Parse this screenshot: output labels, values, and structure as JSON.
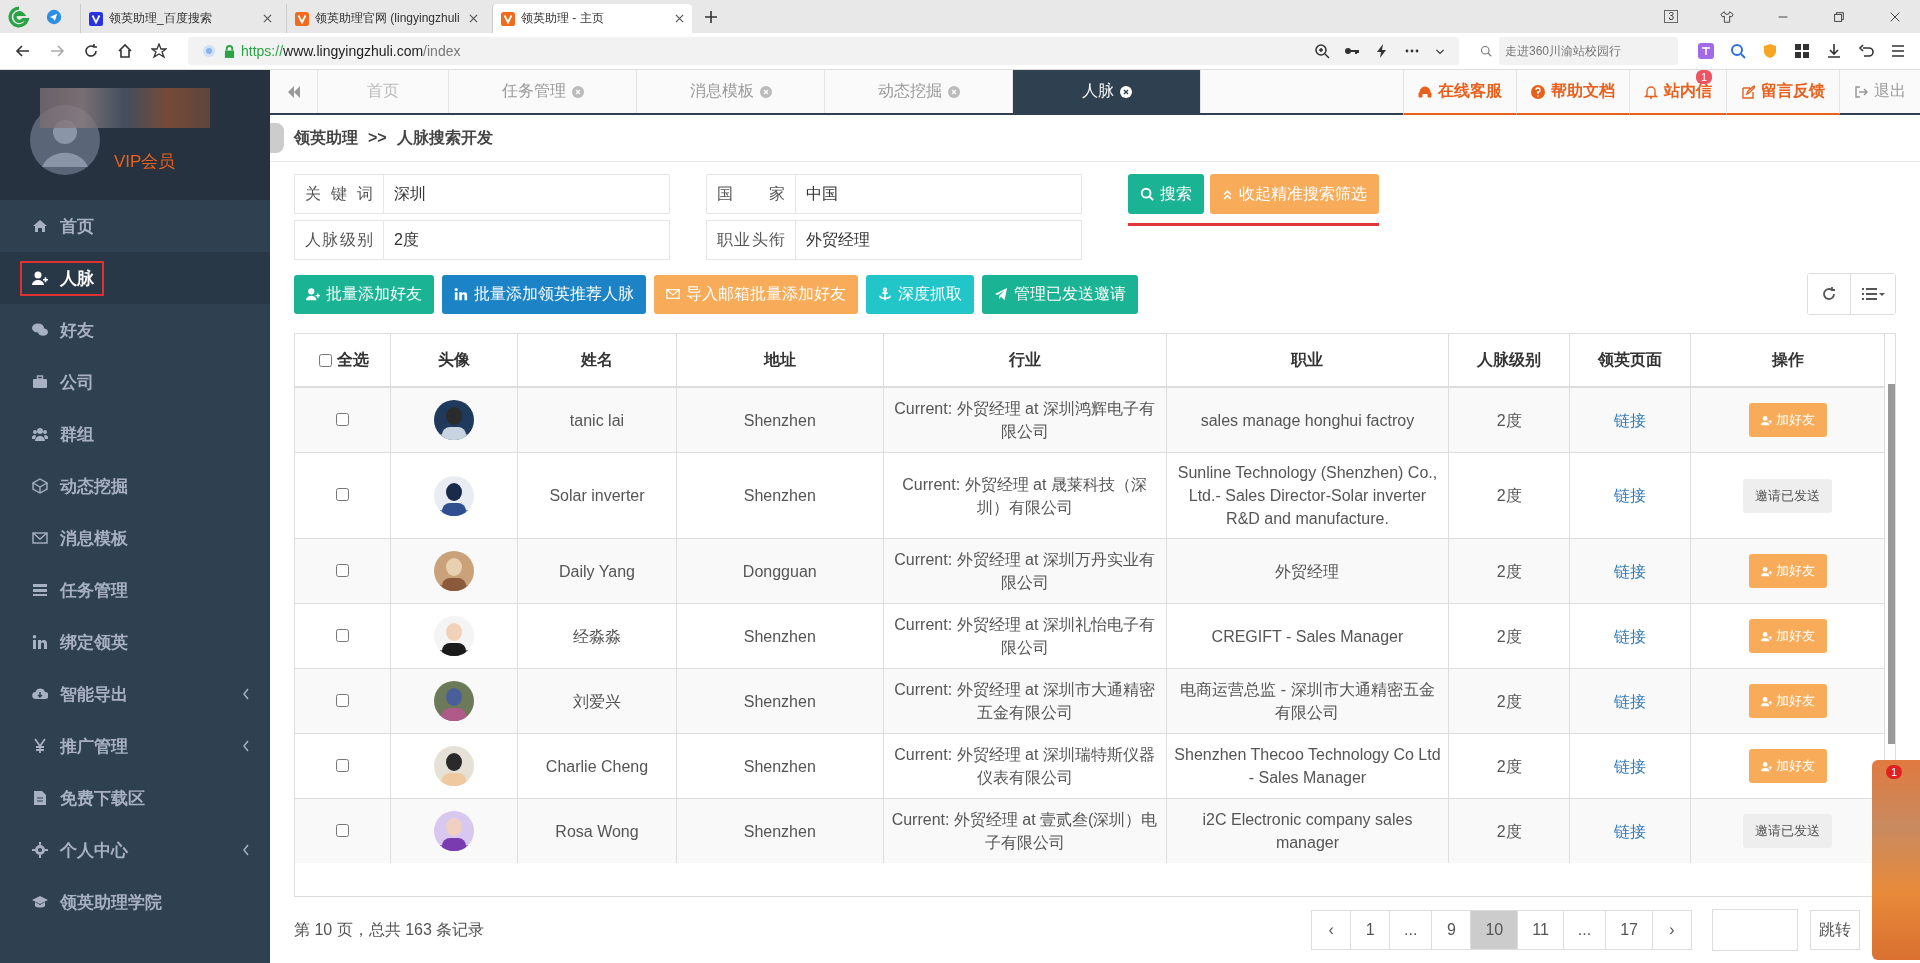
{
  "browser": {
    "tabs": [
      {
        "title": "领英助理_百度搜索",
        "selected": false
      },
      {
        "title": "领英助理官网 (lingyingzhuli",
        "selected": false
      },
      {
        "title": "领英助理 - 主页",
        "selected": true
      }
    ],
    "url_scheme": "https://",
    "url_host": "www.lingyingzhuli.com",
    "url_path": "/index",
    "search_placeholder": "走进360川渝站校园行",
    "window_count": "3"
  },
  "sidebar": {
    "member_label": "VIP会员",
    "items": [
      {
        "label": "首页",
        "selected": false,
        "submenu": false
      },
      {
        "label": "人脉",
        "selected": true,
        "submenu": false
      },
      {
        "label": "好友",
        "selected": false,
        "submenu": false
      },
      {
        "label": "公司",
        "selected": false,
        "submenu": false
      },
      {
        "label": "群组",
        "selected": false,
        "submenu": false
      },
      {
        "label": "动态挖掘",
        "selected": false,
        "submenu": false
      },
      {
        "label": "消息模板",
        "selected": false,
        "submenu": false
      },
      {
        "label": "任务管理",
        "selected": false,
        "submenu": false
      },
      {
        "label": "绑定领英",
        "selected": false,
        "submenu": false
      },
      {
        "label": "智能导出",
        "selected": false,
        "submenu": true
      },
      {
        "label": "推广管理",
        "selected": false,
        "submenu": true
      },
      {
        "label": "免费下载区",
        "selected": false,
        "submenu": false
      },
      {
        "label": "个人中心",
        "selected": false,
        "submenu": true
      },
      {
        "label": "领英助理学院",
        "selected": false,
        "submenu": false
      }
    ]
  },
  "page_tabs": [
    {
      "label": "首页",
      "closable": false,
      "selected": false
    },
    {
      "label": "任务管理",
      "closable": true,
      "selected": false
    },
    {
      "label": "消息模板",
      "closable": true,
      "selected": false
    },
    {
      "label": "动态挖掘",
      "closable": true,
      "selected": false
    },
    {
      "label": "人脉",
      "closable": true,
      "selected": true
    }
  ],
  "header_links": [
    {
      "label": "在线客服"
    },
    {
      "label": "帮助文档"
    },
    {
      "label": "站内信",
      "badge": "1"
    },
    {
      "label": "留言反馈"
    }
  ],
  "logout": "退出",
  "breadcrumb": {
    "root": "领英助理",
    "separator": ">>",
    "current": "人脉搜索开发"
  },
  "filters": [
    {
      "label": "关 键 词",
      "value": "深圳"
    },
    {
      "label": "国 家",
      "value": "中国"
    },
    {
      "label": "人脉级别",
      "value": "2度"
    },
    {
      "label": "职业头衔",
      "value": "外贸经理"
    }
  ],
  "search_button": "搜索",
  "collapse_button": "收起精准搜索筛选",
  "actions": [
    {
      "label": "批量添加好友",
      "color": "#1ab394"
    },
    {
      "label": "批量添加领英推荐人脉",
      "color": "#1c84c6"
    },
    {
      "label": "导入邮箱批量添加好友",
      "color": "#f8ac59"
    },
    {
      "label": "深度抓取",
      "color": "#23c6c8"
    },
    {
      "label": "管理已发送邀请",
      "color": "#1ab394"
    }
  ],
  "table": {
    "select_all": "全选",
    "select_all_checked": false,
    "columns": [
      "头像",
      "姓名",
      "地址",
      "行业",
      "职业",
      "人脉级别",
      "领英页面",
      "操作"
    ],
    "rows": [
      {
        "name": "tanic lai",
        "location": "Shenzhen",
        "industry": "Current: 外贸经理 at 深圳鸿辉电子有限公司",
        "job": "sales manage honghui factroy",
        "level": "2度",
        "link": "链接",
        "action": "加好友",
        "kind": "add",
        "checked": false
      },
      {
        "name": "Solar inverter",
        "location": "Shenzhen",
        "industry": "Current: 外贸经理 at 晟莱科技（深圳）有限公司",
        "job": "Sunline Technology (Shenzhen) Co., Ltd.- Sales Director-Solar inverter R&D and manufacture.",
        "level": "2度",
        "link": "链接",
        "action": "邀请已发送",
        "kind": "sent",
        "checked": false
      },
      {
        "name": "Daily Yang",
        "location": "Dongguan",
        "industry": "Current: 外贸经理 at 深圳万丹实业有限公司",
        "job": "外贸经理",
        "level": "2度",
        "link": "链接",
        "action": "加好友",
        "kind": "add",
        "checked": false
      },
      {
        "name": "经淼淼",
        "location": "Shenzhen",
        "industry": "Current: 外贸经理 at 深圳礼怡电子有限公司",
        "job": "CREGIFT - Sales Manager",
        "level": "2度",
        "link": "链接",
        "action": "加好友",
        "kind": "add",
        "checked": false
      },
      {
        "name": "刘爱兴",
        "location": "Shenzhen",
        "industry": "Current: 外贸经理 at 深圳市大通精密五金有限公司",
        "job": "电商运营总监 - 深圳市大通精密五金有限公司",
        "level": "2度",
        "link": "链接",
        "action": "加好友",
        "kind": "add",
        "checked": false
      },
      {
        "name": "Charlie Cheng",
        "location": "Shenzhen",
        "industry": "Current: 外贸经理 at 深圳瑞特斯仪器仪表有限公司",
        "job": "Shenzhen Thecoo Technology Co Ltd - Sales Manager",
        "level": "2度",
        "link": "链接",
        "action": "加好友",
        "kind": "add",
        "checked": false
      },
      {
        "name": "Rosa Wong",
        "location": "Shenzhen",
        "industry": "Current: 外贸经理 at 壹贰叁(深圳）电子有限公司",
        "job": "i2C Electronic company sales manager",
        "level": "2度",
        "link": "链接",
        "action": "邀请已发送",
        "kind": "sent",
        "checked": false
      }
    ]
  },
  "pagination": {
    "summary": "第 10 页，总共 163 条记录",
    "prev": "‹",
    "next": "›",
    "pages": [
      {
        "label": "1",
        "selected": false
      },
      {
        "label": "...",
        "selected": false
      },
      {
        "label": "9",
        "selected": false
      },
      {
        "label": "10",
        "selected": true
      },
      {
        "label": "11",
        "selected": false
      },
      {
        "label": "...",
        "selected": false
      },
      {
        "label": "17",
        "selected": false
      }
    ],
    "jump": "跳转"
  },
  "chat_widget": {
    "badge": "1"
  }
}
